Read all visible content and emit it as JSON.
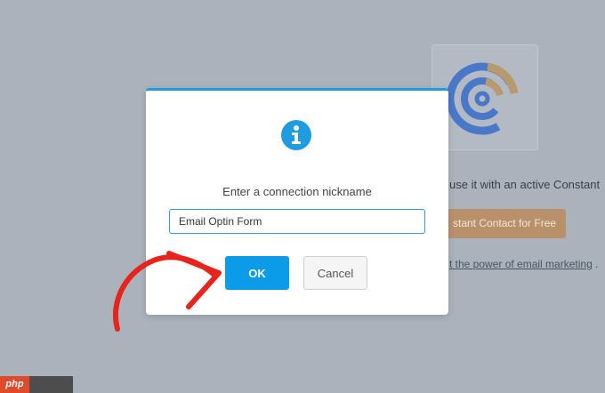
{
  "modal": {
    "prompt": "Enter a connection nickname",
    "input_value": "Email Optin Form",
    "ok_label": "OK",
    "cancel_label": "Cancel",
    "accent_color": "#1f9be0"
  },
  "background": {
    "description_text": "use it with an active Constant",
    "cta_label": "stant Contact for Free",
    "link_text": "t the power of email marketing",
    "link_suffix": "."
  },
  "watermark": {
    "label": "php"
  },
  "icons": {
    "modal": "info-icon",
    "brand": "constant-contact-logo-icon",
    "annotation": "red-arrow-icon"
  }
}
